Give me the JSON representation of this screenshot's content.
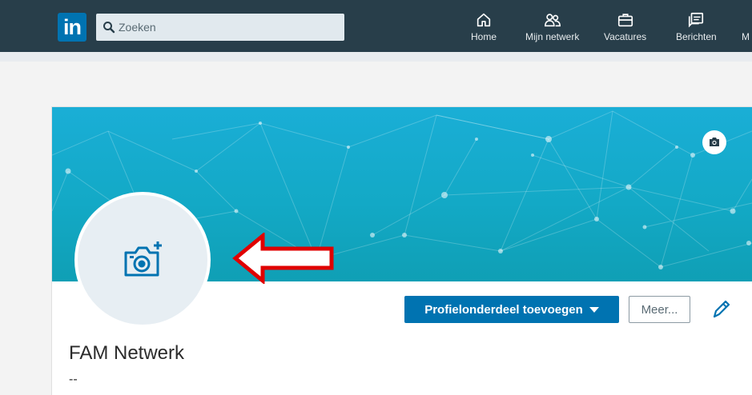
{
  "header": {
    "logo_text": "in",
    "search": {
      "placeholder": "Zoeken",
      "value": ""
    },
    "nav": [
      {
        "label": "Home",
        "icon": "home-icon"
      },
      {
        "label": "Mijn netwerk",
        "icon": "people-icon"
      },
      {
        "label": "Vacatures",
        "icon": "briefcase-icon"
      },
      {
        "label": "Berichten",
        "icon": "messages-icon"
      },
      {
        "label": "M",
        "icon": "notifications-icon"
      }
    ]
  },
  "profile": {
    "name": "FAM Netwerk",
    "headline": "--",
    "add_section_button": "Profielonderdeel toevoegen",
    "more_button": "Meer...",
    "banner_camera_icon": "camera-icon",
    "avatar_icon": "add-photo-camera-icon",
    "annotation_arrow": "red-arrow-icon"
  },
  "colors": {
    "navbar": "#283e4a",
    "brand": "#0073b1",
    "banner": "#13a9c6",
    "arrow": "#e00000"
  }
}
